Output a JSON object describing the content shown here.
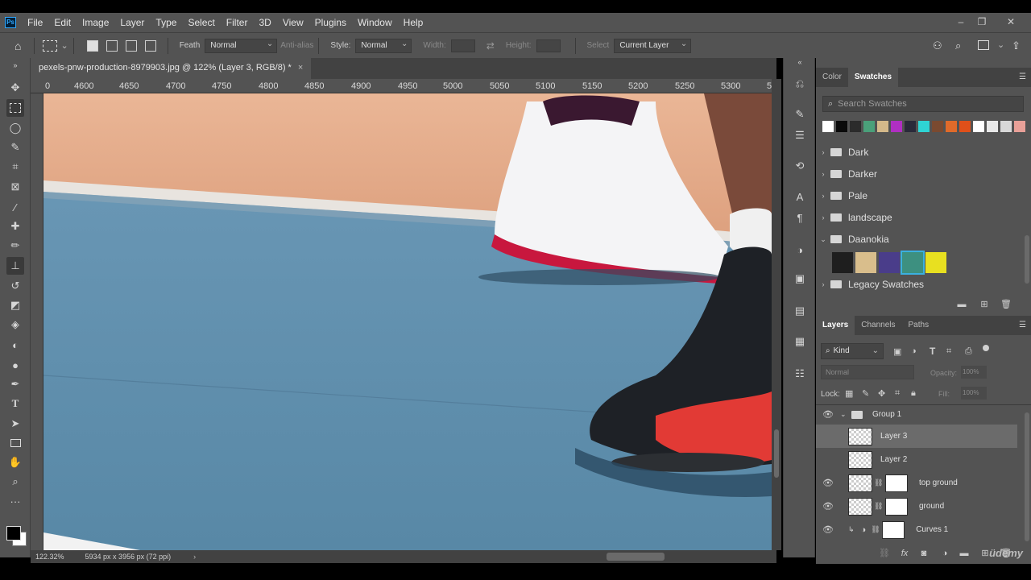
{
  "menubar": {
    "app_icon": "photoshop-logo",
    "app_logo_text": "Ps",
    "items": [
      "File",
      "Edit",
      "Image",
      "Layer",
      "Type",
      "Select",
      "Filter",
      "3D",
      "View",
      "Plugins",
      "Window",
      "Help"
    ]
  },
  "options_bar": {
    "feather_label": "Feath",
    "feather_value": "Normal",
    "anti_alias_label": "Anti-alias",
    "style_label": "Style:",
    "style_value": "Normal",
    "width_label": "Width:",
    "height_label": "Height:",
    "select_label": "Select",
    "select_value": "Current Layer"
  },
  "document": {
    "tab_title": "pexels-pnw-production-8979903.jpg @ 122% (Layer 3, RGB/8) *",
    "close_glyph": "×",
    "ruler_ticks": [
      "0",
      "4600",
      "4650",
      "4700",
      "4750",
      "4800",
      "4850",
      "4900",
      "4950",
      "5000",
      "5050",
      "5100",
      "5150",
      "5200",
      "5250",
      "5300",
      "5"
    ],
    "zoom": "122.32%",
    "doc_size": "5934 px x 3956 px (72 ppi)"
  },
  "color_panel": {
    "tabs": [
      "Color",
      "Swatches"
    ],
    "active_tab": "Swatches",
    "search_placeholder": "Search Swatches",
    "recent_swatches": [
      "#ffffff",
      "#0a0a0a",
      "#2b2b2b",
      "#4aa07a",
      "#d4b98a",
      "#b02fc2",
      "#2a2a3a",
      "#2fd4d4",
      "#7a4a30",
      "#e06a2a",
      "#e0501a",
      "#ffffff",
      "#e8e8e8",
      "#d8d8d8",
      "#e8a098"
    ],
    "folders": [
      "Dark",
      "Darker",
      "Pale",
      "landscape",
      "Daanokia",
      "Legacy Swatches"
    ],
    "expanded_folder": "Daanokia",
    "daanokia_swatches": [
      "#1e1e1e",
      "#d9be8c",
      "#4a3d8a",
      "#3d9080",
      "#e8e020"
    ]
  },
  "layers_panel": {
    "tabs": [
      "Layers",
      "Channels",
      "Paths"
    ],
    "active_tab": "Layers",
    "filter_kind": "Kind",
    "blend_mode": "Normal",
    "opacity_label": "Opacity:",
    "opacity_value": "100%",
    "lock_label": "Lock:",
    "fill_label": "Fill:",
    "fill_value": "100%",
    "layers": [
      {
        "name": "Group 1",
        "visible": true,
        "type": "group"
      },
      {
        "name": "Layer 3",
        "visible": false,
        "type": "pixel",
        "selected": true
      },
      {
        "name": "Layer 2",
        "visible": false,
        "type": "pixel"
      },
      {
        "name": "top ground",
        "visible": true,
        "type": "masked"
      },
      {
        "name": "ground",
        "visible": true,
        "type": "masked"
      },
      {
        "name": "Curves 1",
        "visible": true,
        "type": "adjustment"
      }
    ]
  },
  "watermark": "üdemy",
  "colors": {
    "chrome_dark": "#535353",
    "panel_tab_bg": "#424242",
    "selection": "#6b6b6b",
    "court_blue": "#5d8aa8",
    "court_clay": "#e3aa88"
  }
}
